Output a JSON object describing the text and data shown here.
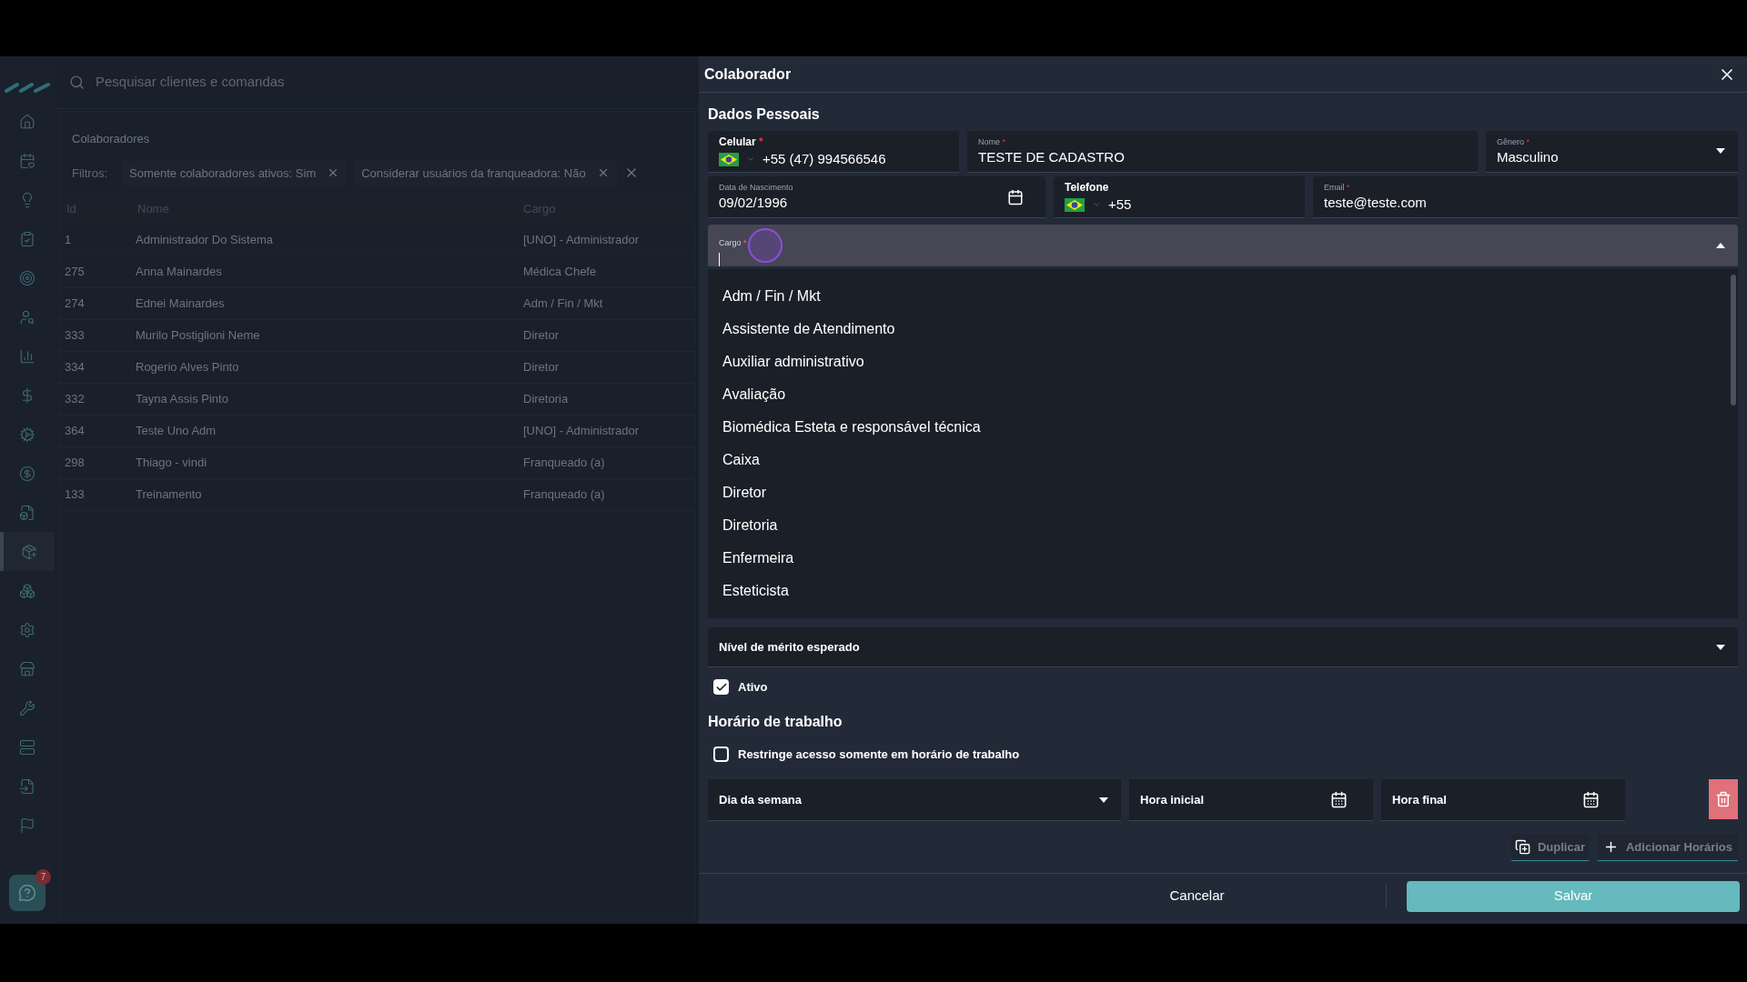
{
  "sidebar": {
    "items": [
      {
        "kind": "home",
        "selected": false
      },
      {
        "kind": "calendar",
        "selected": false
      },
      {
        "kind": "bulb",
        "selected": false
      },
      {
        "kind": "clipboard",
        "selected": false
      },
      {
        "kind": "target",
        "selected": false
      },
      {
        "kind": "user-search",
        "selected": false
      },
      {
        "kind": "chart",
        "selected": false
      },
      {
        "kind": "dollar",
        "selected": false
      },
      {
        "kind": "cog-play",
        "selected": false
      },
      {
        "kind": "coin",
        "selected": false
      },
      {
        "kind": "box-file",
        "selected": false
      },
      {
        "kind": "box-plus",
        "selected": true
      },
      {
        "kind": "boxes",
        "selected": false
      },
      {
        "kind": "settings",
        "selected": false
      },
      {
        "kind": "store",
        "selected": false
      },
      {
        "kind": "wrench",
        "selected": false
      },
      {
        "kind": "server",
        "selected": false
      },
      {
        "kind": "file-input",
        "selected": false
      },
      {
        "kind": "flag",
        "selected": false
      }
    ],
    "help_badge": "7"
  },
  "search": {
    "placeholder": "Pesquisar clientes e comandas"
  },
  "list": {
    "title": "Colaboradores",
    "filters_label": "Filtros:",
    "filters": [
      "Somente colaboradores ativos: Sim",
      "Considerar usuários da franqueadora: Não"
    ],
    "columns": [
      "Id",
      "Nome",
      "Cargo"
    ],
    "rows": [
      [
        "1",
        "Administrador Do Sistema",
        "[UNO] - Administrador"
      ],
      [
        "275",
        "Anna Mainardes",
        "Médica Chefe"
      ],
      [
        "274",
        "Ednei Mainardes",
        "Adm / Fin / Mkt"
      ],
      [
        "333",
        "Murilo Postiglioni Neme",
        "Diretor"
      ],
      [
        "334",
        "Rogerio Alves Pinto",
        "Diretor"
      ],
      [
        "332",
        "Tayna Assis Pinto",
        "Diretoria"
      ],
      [
        "364",
        "Teste Uno Adm",
        "[UNO] - Administrador"
      ],
      [
        "298",
        "Thiago - vindi",
        "Franqueado (a)"
      ],
      [
        "133",
        "Treinamento",
        "Franqueado (a)"
      ]
    ]
  },
  "drawer": {
    "title": "Colaborador",
    "section": "Dados Pessoais",
    "required_mark": "*",
    "celular": {
      "label": "Celular",
      "value": "+55 (47) 994566546"
    },
    "nome": {
      "label": "Nome",
      "value": "TESTE DE CADASTRO"
    },
    "genero": {
      "label": "Gênero",
      "value": "Masculino"
    },
    "nascimento": {
      "label": "Data de Nascimento",
      "value": "09/02/1996"
    },
    "telefone": {
      "label": "Telefone",
      "value": "+55"
    },
    "email": {
      "label": "Email",
      "value": "teste@teste.com"
    },
    "cargo": {
      "label": "Cargo",
      "expanded": true,
      "options": [
        "Adm / Fin / Mkt",
        "Assistente de Atendimento",
        "Auxiliar administrativo",
        "Avaliação",
        "Biomédica Esteta e responsável técnica",
        "Caixa",
        "Diretor",
        "Diretoria",
        "Enfermeira",
        "Esteticista"
      ]
    },
    "merito": {
      "placeholder": "Nível de mérito esperado"
    },
    "ativo": {
      "label": "Ativo",
      "checked": true
    },
    "schedule_title": "Horário de trabalho",
    "restringe": {
      "label": "Restringe acesso somente em horário de trabalho",
      "checked": false
    },
    "dia": {
      "placeholder": "Dia da semana"
    },
    "hora_inicial": {
      "placeholder": "Hora inicial"
    },
    "hora_final": {
      "placeholder": "Hora final"
    },
    "duplicar": "Duplicar",
    "adicionar": "Adicionar Horários",
    "cancelar": "Cancelar",
    "salvar": "Salvar"
  }
}
